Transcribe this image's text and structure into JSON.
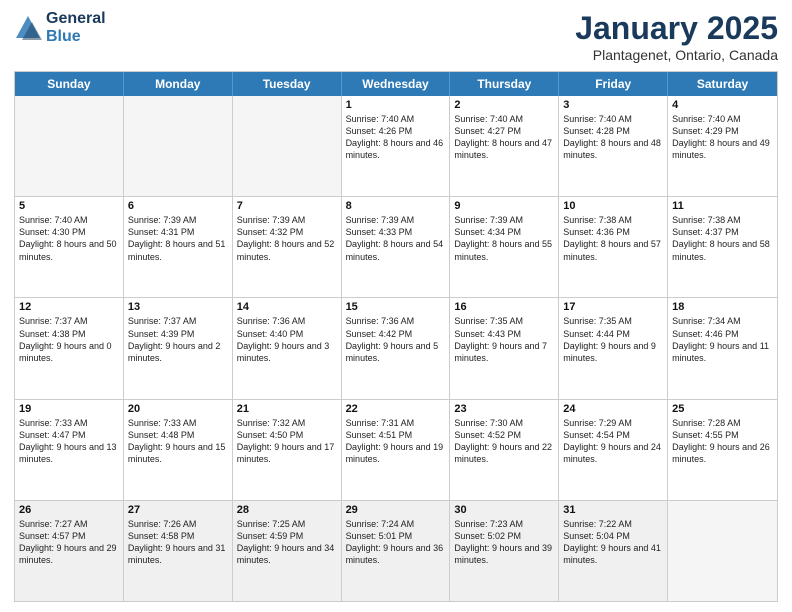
{
  "header": {
    "logo_line1": "General",
    "logo_line2": "Blue",
    "month": "January 2025",
    "location": "Plantagenet, Ontario, Canada"
  },
  "days_of_week": [
    "Sunday",
    "Monday",
    "Tuesday",
    "Wednesday",
    "Thursday",
    "Friday",
    "Saturday"
  ],
  "weeks": [
    [
      {
        "day": "",
        "info": "",
        "empty": true
      },
      {
        "day": "",
        "info": "",
        "empty": true
      },
      {
        "day": "",
        "info": "",
        "empty": true
      },
      {
        "day": "1",
        "info": "Sunrise: 7:40 AM\nSunset: 4:26 PM\nDaylight: 8 hours\nand 46 minutes."
      },
      {
        "day": "2",
        "info": "Sunrise: 7:40 AM\nSunset: 4:27 PM\nDaylight: 8 hours\nand 47 minutes."
      },
      {
        "day": "3",
        "info": "Sunrise: 7:40 AM\nSunset: 4:28 PM\nDaylight: 8 hours\nand 48 minutes."
      },
      {
        "day": "4",
        "info": "Sunrise: 7:40 AM\nSunset: 4:29 PM\nDaylight: 8 hours\nand 49 minutes."
      }
    ],
    [
      {
        "day": "5",
        "info": "Sunrise: 7:40 AM\nSunset: 4:30 PM\nDaylight: 8 hours\nand 50 minutes."
      },
      {
        "day": "6",
        "info": "Sunrise: 7:39 AM\nSunset: 4:31 PM\nDaylight: 8 hours\nand 51 minutes."
      },
      {
        "day": "7",
        "info": "Sunrise: 7:39 AM\nSunset: 4:32 PM\nDaylight: 8 hours\nand 52 minutes."
      },
      {
        "day": "8",
        "info": "Sunrise: 7:39 AM\nSunset: 4:33 PM\nDaylight: 8 hours\nand 54 minutes."
      },
      {
        "day": "9",
        "info": "Sunrise: 7:39 AM\nSunset: 4:34 PM\nDaylight: 8 hours\nand 55 minutes."
      },
      {
        "day": "10",
        "info": "Sunrise: 7:38 AM\nSunset: 4:36 PM\nDaylight: 8 hours\nand 57 minutes."
      },
      {
        "day": "11",
        "info": "Sunrise: 7:38 AM\nSunset: 4:37 PM\nDaylight: 8 hours\nand 58 minutes."
      }
    ],
    [
      {
        "day": "12",
        "info": "Sunrise: 7:37 AM\nSunset: 4:38 PM\nDaylight: 9 hours\nand 0 minutes."
      },
      {
        "day": "13",
        "info": "Sunrise: 7:37 AM\nSunset: 4:39 PM\nDaylight: 9 hours\nand 2 minutes."
      },
      {
        "day": "14",
        "info": "Sunrise: 7:36 AM\nSunset: 4:40 PM\nDaylight: 9 hours\nand 3 minutes."
      },
      {
        "day": "15",
        "info": "Sunrise: 7:36 AM\nSunset: 4:42 PM\nDaylight: 9 hours\nand 5 minutes."
      },
      {
        "day": "16",
        "info": "Sunrise: 7:35 AM\nSunset: 4:43 PM\nDaylight: 9 hours\nand 7 minutes."
      },
      {
        "day": "17",
        "info": "Sunrise: 7:35 AM\nSunset: 4:44 PM\nDaylight: 9 hours\nand 9 minutes."
      },
      {
        "day": "18",
        "info": "Sunrise: 7:34 AM\nSunset: 4:46 PM\nDaylight: 9 hours\nand 11 minutes."
      }
    ],
    [
      {
        "day": "19",
        "info": "Sunrise: 7:33 AM\nSunset: 4:47 PM\nDaylight: 9 hours\nand 13 minutes."
      },
      {
        "day": "20",
        "info": "Sunrise: 7:33 AM\nSunset: 4:48 PM\nDaylight: 9 hours\nand 15 minutes."
      },
      {
        "day": "21",
        "info": "Sunrise: 7:32 AM\nSunset: 4:50 PM\nDaylight: 9 hours\nand 17 minutes."
      },
      {
        "day": "22",
        "info": "Sunrise: 7:31 AM\nSunset: 4:51 PM\nDaylight: 9 hours\nand 19 minutes."
      },
      {
        "day": "23",
        "info": "Sunrise: 7:30 AM\nSunset: 4:52 PM\nDaylight: 9 hours\nand 22 minutes."
      },
      {
        "day": "24",
        "info": "Sunrise: 7:29 AM\nSunset: 4:54 PM\nDaylight: 9 hours\nand 24 minutes."
      },
      {
        "day": "25",
        "info": "Sunrise: 7:28 AM\nSunset: 4:55 PM\nDaylight: 9 hours\nand 26 minutes."
      }
    ],
    [
      {
        "day": "26",
        "info": "Sunrise: 7:27 AM\nSunset: 4:57 PM\nDaylight: 9 hours\nand 29 minutes."
      },
      {
        "day": "27",
        "info": "Sunrise: 7:26 AM\nSunset: 4:58 PM\nDaylight: 9 hours\nand 31 minutes."
      },
      {
        "day": "28",
        "info": "Sunrise: 7:25 AM\nSunset: 4:59 PM\nDaylight: 9 hours\nand 34 minutes."
      },
      {
        "day": "29",
        "info": "Sunrise: 7:24 AM\nSunset: 5:01 PM\nDaylight: 9 hours\nand 36 minutes."
      },
      {
        "day": "30",
        "info": "Sunrise: 7:23 AM\nSunset: 5:02 PM\nDaylight: 9 hours\nand 39 minutes."
      },
      {
        "day": "31",
        "info": "Sunrise: 7:22 AM\nSunset: 5:04 PM\nDaylight: 9 hours\nand 41 minutes."
      },
      {
        "day": "",
        "info": "",
        "empty": true
      }
    ]
  ]
}
